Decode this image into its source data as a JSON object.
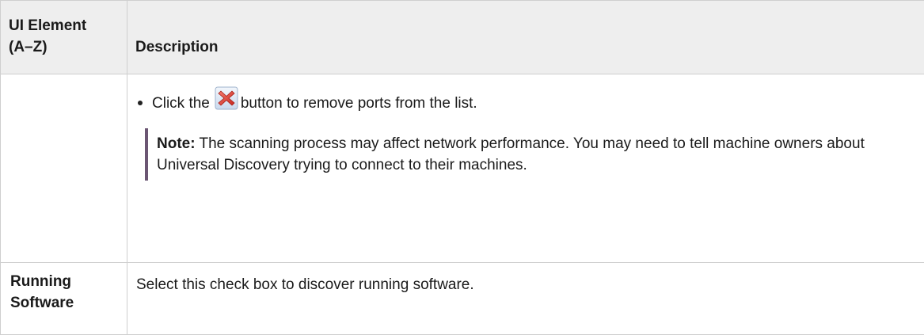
{
  "table": {
    "headers": {
      "element": "UI Element\n(A–Z)",
      "element_line1": "UI Element",
      "element_line2": "(A–Z)",
      "description": "Description"
    },
    "rows": [
      {
        "element": "",
        "bullet": {
          "prefix": "Click the",
          "icon": "remove-x-icon",
          "suffix": "button to remove ports from the list."
        },
        "note": {
          "label": "Note:",
          "text": "The scanning process may affect network performance. You may need to tell machine owners about Universal Discovery trying to connect to their machines."
        }
      },
      {
        "element_line1": "Running",
        "element_line2": "Software",
        "description": "Select this check box to discover running software."
      }
    ]
  },
  "colors": {
    "header_bg": "#eeeeee",
    "border": "#cfcfcf",
    "note_bar": "#6b5673",
    "icon_red": "#e0483d",
    "icon_bg": "#dbe7f5"
  }
}
